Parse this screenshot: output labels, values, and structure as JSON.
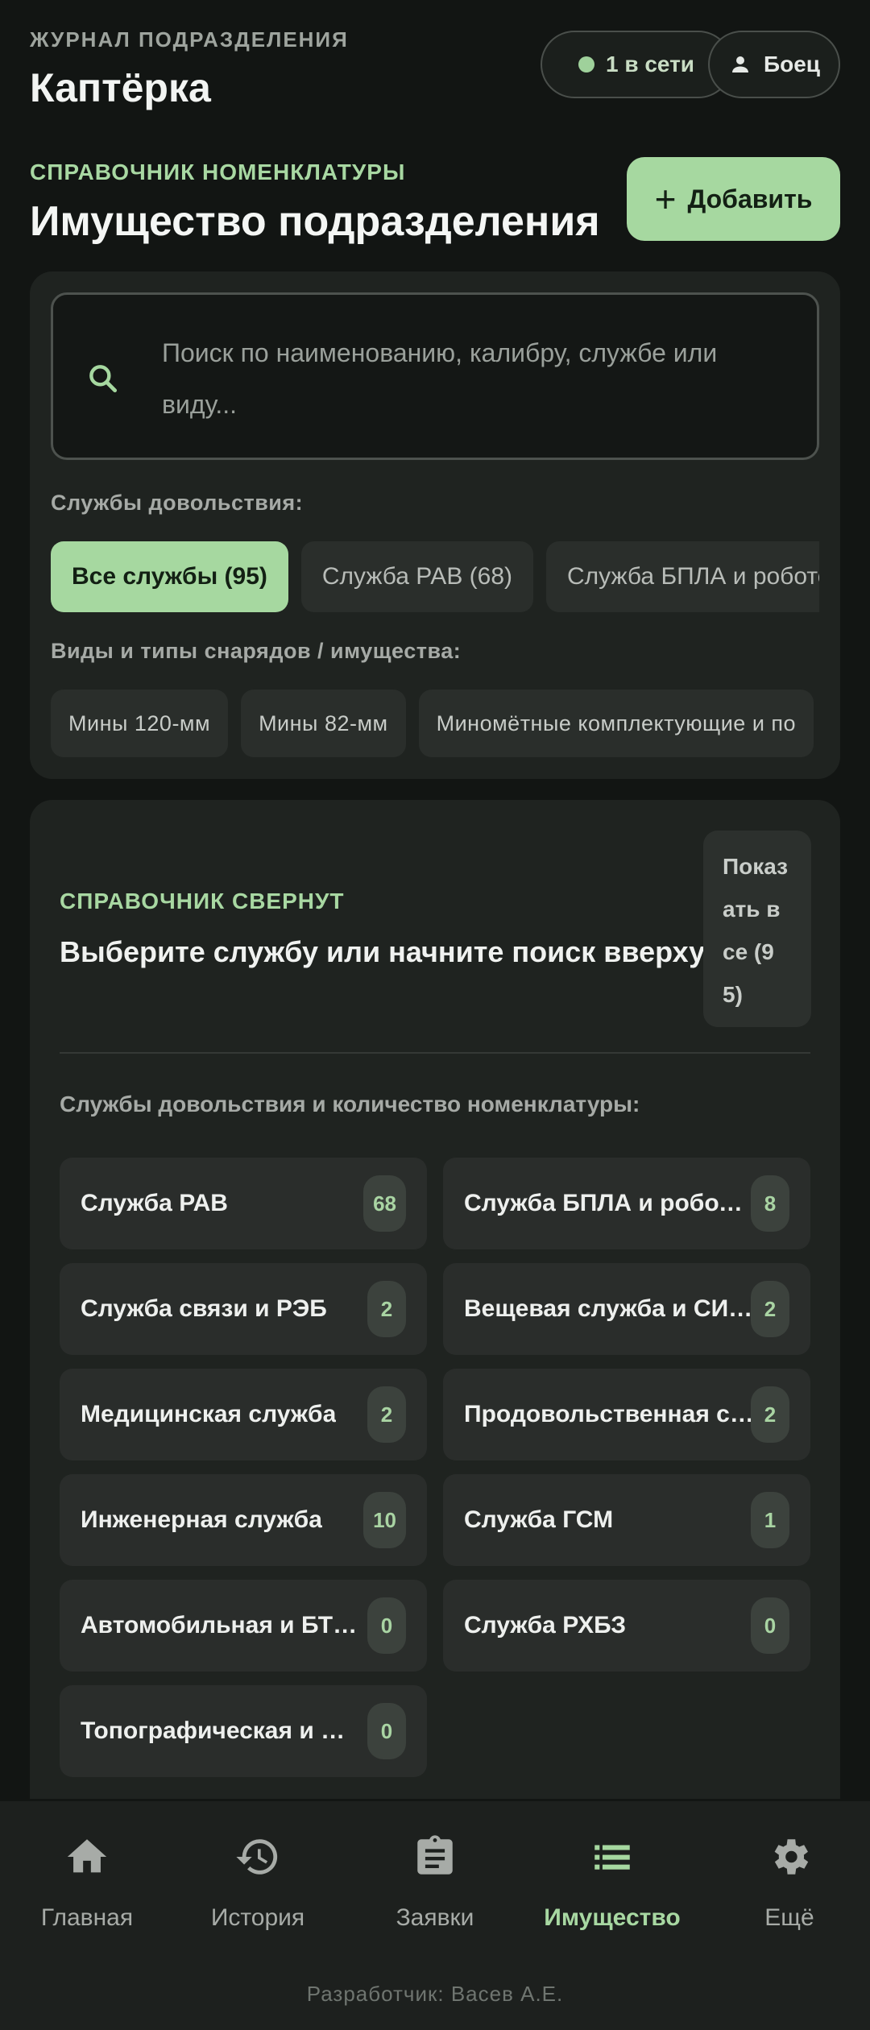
{
  "header": {
    "journal_label": "ЖУРНАЛ ПОДРАЗДЕЛЕНИЯ",
    "app_title": "Каптёрка",
    "online_status": "1 в сети",
    "role": "Боец"
  },
  "section": {
    "caption": "СПРАВОЧНИК НОМЕНКЛАТУРЫ",
    "title": "Имущество подразделения",
    "add_button": "Добавить"
  },
  "search": {
    "placeholder": "Поиск по наименованию, калибру, службе или виду...",
    "value": ""
  },
  "filters": {
    "services_label": "Службы довольствия:",
    "services": [
      {
        "label": "Все службы (95)",
        "active": true
      },
      {
        "label": "Служба РАВ (68)",
        "active": false
      },
      {
        "label": "Служба БПЛА и роботот",
        "active": false
      }
    ],
    "kinds_label": "Виды и типы снарядов / имущества:",
    "kinds": [
      {
        "label": "Мины 120-мм"
      },
      {
        "label": "Мины 82-мм"
      },
      {
        "label": "Миномётные комплектующие и по"
      }
    ]
  },
  "collapsed": {
    "caption": "СПРАВОЧНИК СВЕРНУТ",
    "title": "Выберите службу или начните поиск вверху",
    "show_all": "Показать все (95)",
    "services_caption": "Службы довольствия и количество номенклатуры:"
  },
  "services": [
    {
      "name": "Служба РАВ",
      "count": "68"
    },
    {
      "name": "Служба БПЛА и робототехники",
      "count": "8"
    },
    {
      "name": "Служба связи и РЭБ",
      "count": "2"
    },
    {
      "name": "Вещевая служба и СИБЗ",
      "count": "2"
    },
    {
      "name": "Медицинская служба",
      "count": "2"
    },
    {
      "name": "Продовольственная служба",
      "count": "2"
    },
    {
      "name": "Инженерная служба",
      "count": "10"
    },
    {
      "name": "Служба ГСМ",
      "count": "1"
    },
    {
      "name": "Автомобильная и БТ служба",
      "count": "0"
    },
    {
      "name": "Служба РХБЗ",
      "count": "0"
    },
    {
      "name": "Топографическая и штабная служба",
      "count": "0"
    }
  ],
  "nav": [
    {
      "label": "Главная",
      "icon": "home-icon",
      "active": false
    },
    {
      "label": "История",
      "icon": "history-icon",
      "active": false
    },
    {
      "label": "Заявки",
      "icon": "clipboard-icon",
      "active": false
    },
    {
      "label": "Имущество",
      "icon": "list-icon",
      "active": true
    },
    {
      "label": "Ещё",
      "icon": "gear-icon",
      "active": false
    }
  ],
  "footer": {
    "developer": "Разработчик: Васев А.Е."
  },
  "colors": {
    "accent": "#a6d8a0",
    "background": "#121513",
    "card": "#1f2320"
  }
}
